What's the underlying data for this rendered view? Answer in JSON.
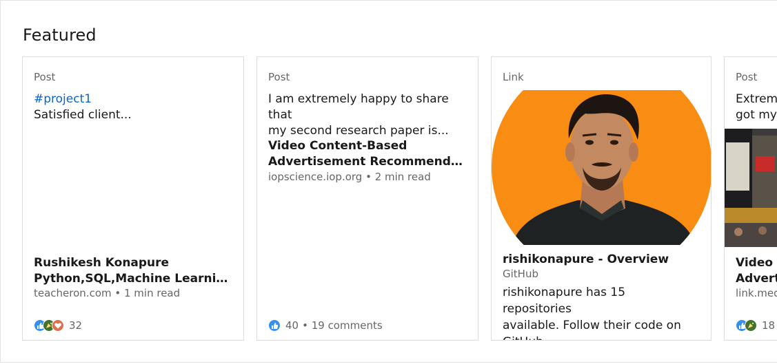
{
  "section": {
    "title": "Featured"
  },
  "cards": [
    {
      "type": "Post",
      "hashtag": "#project1",
      "text": "Satisfied client...",
      "article_title_line1": "Rushikesh Konapure",
      "article_title_line2": "Python,SQL,Machine Learning...",
      "meta": "teacheron.com • 1 min read",
      "reactions_count": "32"
    },
    {
      "type": "Post",
      "text_line1": "I am extremely happy to share that",
      "text_line2": "my second research paper is...",
      "article_title_line1": "Video Content-Based",
      "article_title_line2": "Advertisement Recommendatio...",
      "meta": "iopscience.iop.org • 2 min read",
      "reactions_count": "40",
      "comments": "• 19 comments"
    },
    {
      "type": "Link",
      "link_title": "rishikonapure - Overview",
      "link_source": "GitHub",
      "desc_line1": "rishikonapure has 15 repositories",
      "desc_line2": "available. Follow their code on",
      "desc_line3": "GitHub."
    },
    {
      "type": "Post",
      "text_line1": "Extrem",
      "text_line2": "got my",
      "article_title_line1": "Video C",
      "article_title_line2": "Advert",
      "meta": "link.med",
      "reactions_count": "18"
    }
  ],
  "colors": {
    "hashtag": "#0a66c2",
    "like": "#378fe9",
    "celebrate": "#44712e",
    "love": "#df704d",
    "avatar_bg": "#f98c12"
  },
  "icons": [
    "like-reaction-icon",
    "celebrate-reaction-icon",
    "love-reaction-icon"
  ]
}
